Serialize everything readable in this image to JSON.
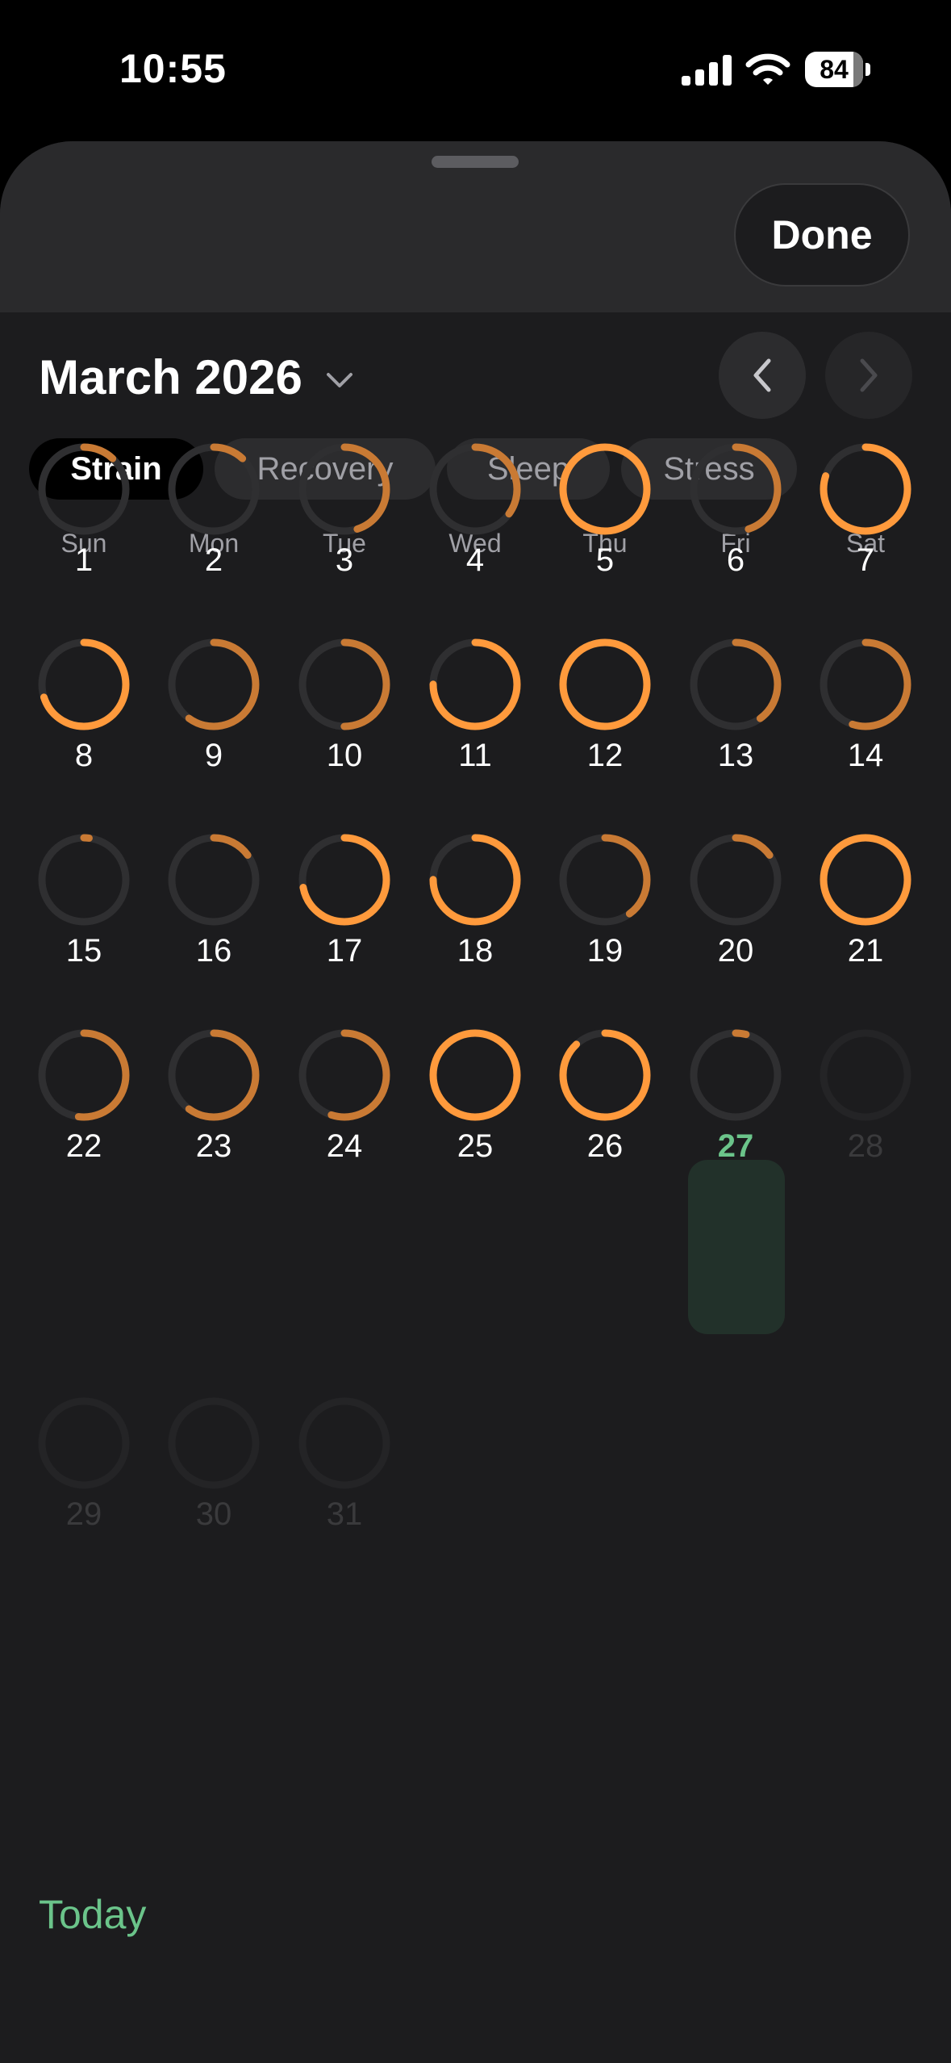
{
  "status_bar": {
    "time": "10:55",
    "battery_percent": 84
  },
  "header": {
    "done_label": "Done"
  },
  "calendar": {
    "month_label": "March 2026",
    "weekdays": [
      "Sun",
      "Mon",
      "Tue",
      "Wed",
      "Thu",
      "Fri",
      "Sat"
    ],
    "today_label": "Today",
    "today_day": 27,
    "days": [
      {
        "day": "1",
        "level": 0.12
      },
      {
        "day": "2",
        "level": 0.12
      },
      {
        "day": "3",
        "level": 0.45
      },
      {
        "day": "4",
        "level": 0.35
      },
      {
        "day": "5",
        "level": 1.0
      },
      {
        "day": "6",
        "level": 0.45
      },
      {
        "day": "7",
        "level": 0.8
      },
      {
        "day": "8",
        "level": 0.7
      },
      {
        "day": "9",
        "level": 0.6
      },
      {
        "day": "10",
        "level": 0.5
      },
      {
        "day": "11",
        "level": 0.75
      },
      {
        "day": "12",
        "level": 1.0
      },
      {
        "day": "13",
        "level": 0.4
      },
      {
        "day": "14",
        "level": 0.55
      },
      {
        "day": "15",
        "level": 0.02
      },
      {
        "day": "16",
        "level": 0.15
      },
      {
        "day": "17",
        "level": 0.72
      },
      {
        "day": "18",
        "level": 0.75
      },
      {
        "day": "19",
        "level": 0.4
      },
      {
        "day": "20",
        "level": 0.15
      },
      {
        "day": "21",
        "level": 1.0
      },
      {
        "day": "22",
        "level": 0.52
      },
      {
        "day": "23",
        "level": 0.6
      },
      {
        "day": "24",
        "level": 0.55
      },
      {
        "day": "25",
        "level": 1.0
      },
      {
        "day": "26",
        "level": 0.88
      },
      {
        "day": "27",
        "level": 0.04
      },
      {
        "day": "28",
        "level": 0
      },
      {
        "day": "29",
        "level": 0
      },
      {
        "day": "30",
        "level": 0
      },
      {
        "day": "31",
        "level": 0
      }
    ]
  },
  "tabs": [
    {
      "label": "Strain",
      "active": true
    },
    {
      "label": "Recovery",
      "active": false
    },
    {
      "label": "Sleep",
      "active": false
    },
    {
      "label": "Stress",
      "active": false
    }
  ],
  "colors": {
    "accent_orange": "#ff9a3c",
    "muted_orange": "#c97a34",
    "today_green": "#6bc48a",
    "track": "#2f2f31"
  }
}
